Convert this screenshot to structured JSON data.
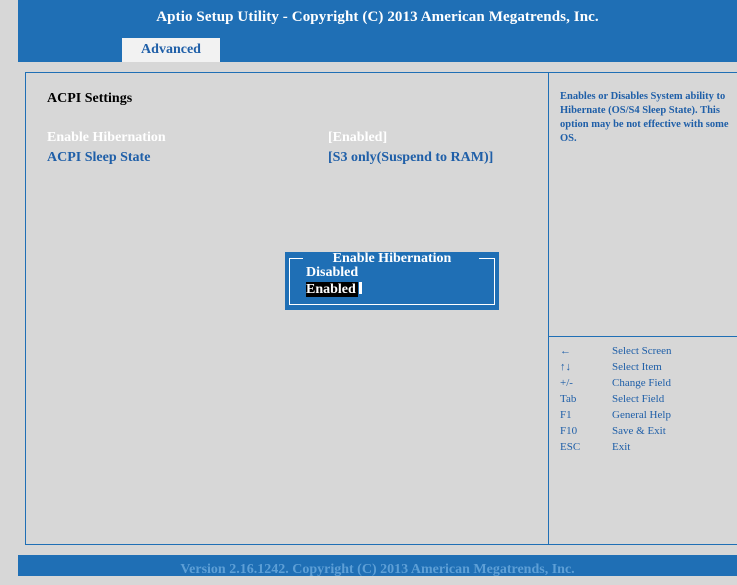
{
  "header": {
    "title": "Aptio Setup Utility - Copyright (C) 2013 American Megatrends, Inc."
  },
  "tabs": [
    {
      "label": "Advanced"
    }
  ],
  "main": {
    "section_title": "ACPI Settings",
    "settings": [
      {
        "label": "Enable Hibernation",
        "value": "[Enabled]"
      },
      {
        "label": "ACPI Sleep State",
        "value": "[S3 only(Suspend to RAM)]"
      }
    ]
  },
  "popup": {
    "title": "Enable Hibernation",
    "options": [
      "Disabled",
      "Enabled"
    ],
    "selected": "Enabled"
  },
  "help": {
    "text": "Enables or Disables System ability to Hibernate (OS/S4 Sleep State). This option may be not effective with some OS."
  },
  "keys": [
    {
      "key": "←",
      "desc": "Select Screen"
    },
    {
      "key": "↑↓",
      "desc": "Select Item"
    },
    {
      "key": "+/-",
      "desc": "Change Field"
    },
    {
      "key": "Tab",
      "desc": "Select Field"
    },
    {
      "key": "F1",
      "desc": "General Help"
    },
    {
      "key": "F10",
      "desc": "Save & Exit"
    },
    {
      "key": "ESC",
      "desc": "Exit"
    }
  ],
  "footer": {
    "text": "Version 2.16.1242. Copyright (C) 2013 American Megatrends, Inc."
  },
  "colors": {
    "accent": "#1f6fb5",
    "background": "#d7d7d7",
    "highlight": "#ffffff"
  }
}
